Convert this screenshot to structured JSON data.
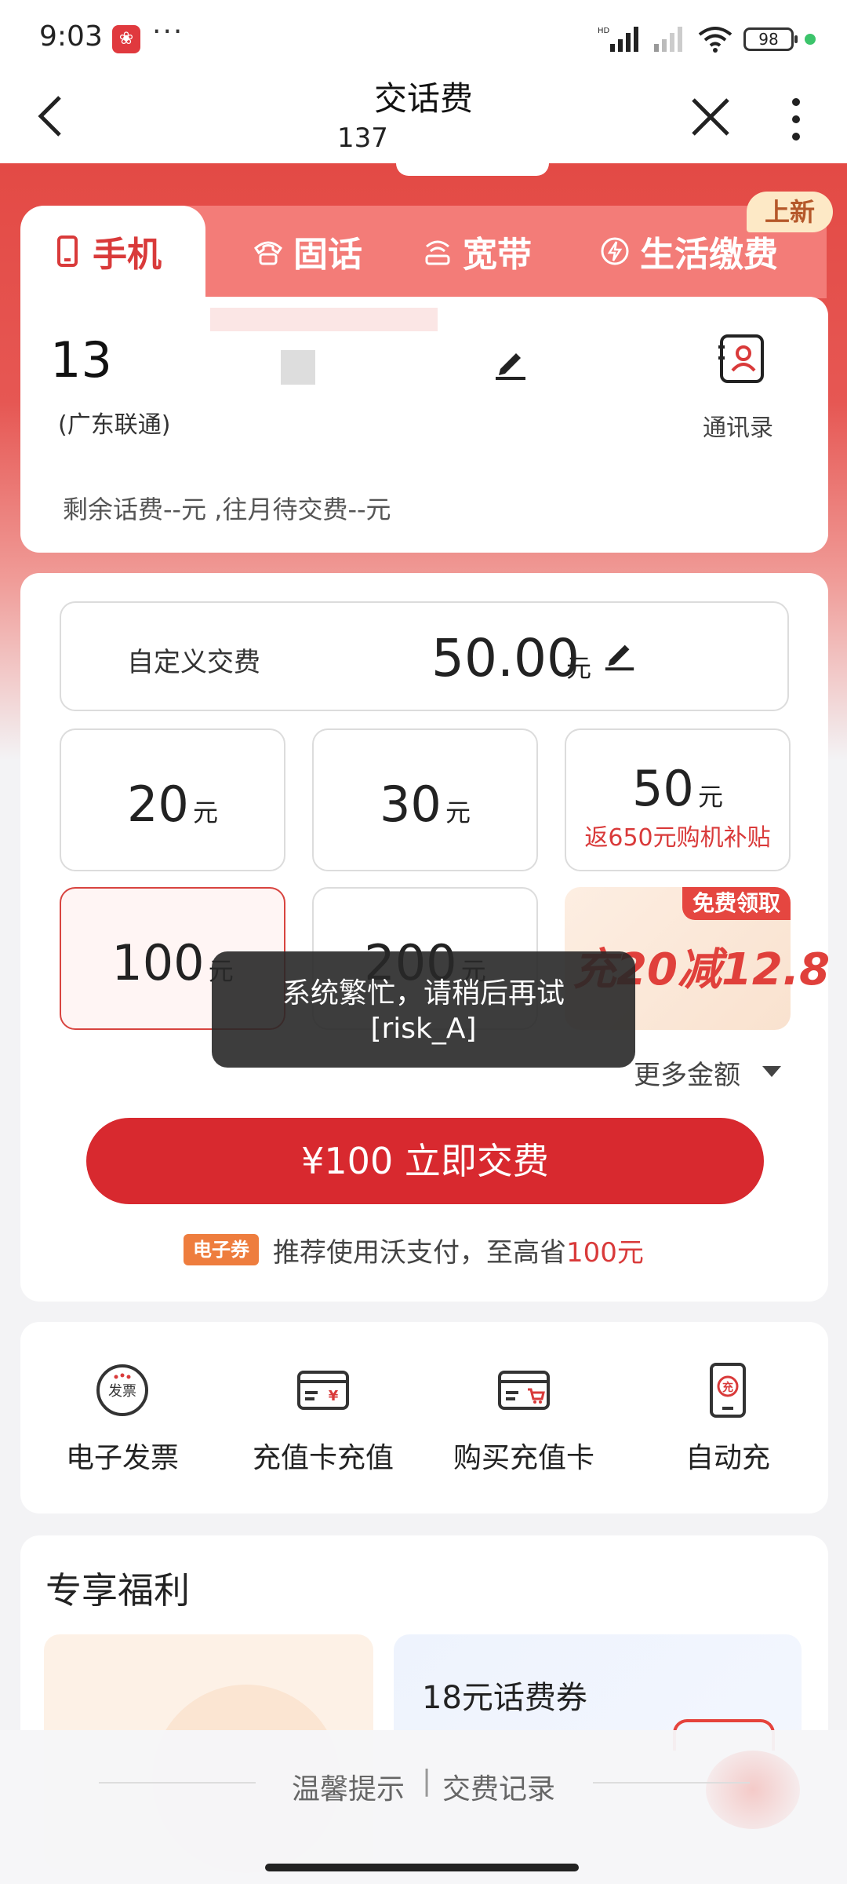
{
  "status_bar": {
    "time": "9:03",
    "battery": "98",
    "hd_label": "HD"
  },
  "nav": {
    "title": "交话费",
    "subtitle": "137"
  },
  "tabs": [
    {
      "label": "手机",
      "active": true
    },
    {
      "label": "固话",
      "active": false
    },
    {
      "label": "宽带",
      "active": false
    },
    {
      "label": "生活缴费",
      "active": false
    }
  ],
  "new_badge": "上新",
  "phone": {
    "number": "13",
    "carrier": "(广东联通)",
    "contacts_label": "通讯录",
    "balance_text": "剩余话费--元 ,往月待交费--元"
  },
  "custom_amount": {
    "label": "自定义交费",
    "value": "50.00",
    "unit": "元"
  },
  "options": [
    {
      "value": "20",
      "unit": "元"
    },
    {
      "value": "30",
      "unit": "元"
    },
    {
      "value": "50",
      "unit": "元",
      "sub": "返650元购机补贴"
    },
    {
      "value": "100",
      "unit": "元",
      "selected": true
    },
    {
      "value": "200",
      "unit": "元"
    }
  ],
  "promo": {
    "badge": "免费领取",
    "text": "充20减12.8"
  },
  "toast": {
    "line1": "系统繁忙，请稍后再试",
    "line2": "[risk_A]"
  },
  "more_amount": "更多金额",
  "pay_button": "¥100 立即交费",
  "epay": {
    "badge": "电子券",
    "text": "推荐使用沃支付，至高省",
    "highlight": "100元"
  },
  "services": [
    {
      "label": "电子发票",
      "icon": "invoice-icon"
    },
    {
      "label": "充值卡充值",
      "icon": "recharge-card-icon"
    },
    {
      "label": "购买充值卡",
      "icon": "buy-card-icon"
    },
    {
      "label": "自动充",
      "icon": "auto-recharge-icon"
    }
  ],
  "benefits": {
    "title": "专享福利",
    "coupon_title": "18元话费券"
  },
  "bottom": {
    "tips": "温馨提示",
    "separator": "|",
    "records": "交费记录"
  },
  "colors": {
    "brand_red": "#d8292f",
    "tab_red": "#d93a3a",
    "header_red": "#e34a45"
  }
}
